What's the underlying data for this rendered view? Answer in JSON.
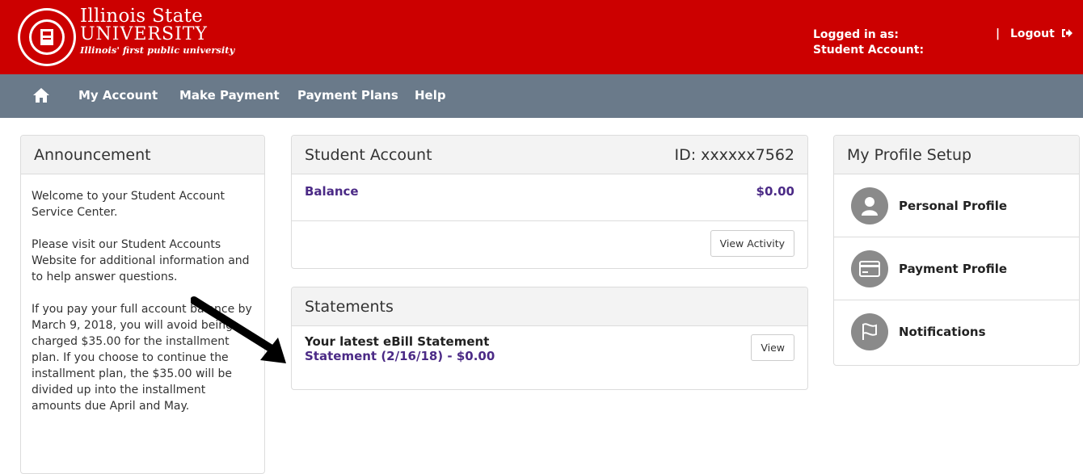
{
  "header": {
    "brand_line1": "Illinois State",
    "brand_line2": "UNIVERSITY",
    "brand_line3": "Illinois' first public university",
    "logged_in_label": "Logged in as:",
    "student_account_label": "Student Account:",
    "logout_label": "Logout",
    "separator": "|",
    "accent_color": "#cc0000"
  },
  "nav": {
    "home_icon": "home-icon",
    "items": [
      "My Account",
      "Make Payment",
      "Payment Plans",
      "Help"
    ]
  },
  "announcement": {
    "title": "Announcement",
    "paragraphs": [
      "Welcome to your Student Account Service Center.",
      "Please visit our Student Accounts Website for additional information and to help answer questions.",
      "If you pay your full account balance by March 9, 2018, you will avoid being charged $35.00 for the installment plan. If you choose to continue the installment plan, the $35.00 will be divided up into the installment amounts due April and May."
    ]
  },
  "student_account": {
    "title": "Student Account",
    "id_label": "ID: xxxxxx7562",
    "balance_label": "Balance",
    "balance_value": "$0.00",
    "view_activity_label": "View Activity"
  },
  "statements": {
    "title": "Statements",
    "latest_label": "Your latest eBill Statement",
    "statement_link": "Statement (2/16/18) - $0.00",
    "view_label": "View"
  },
  "profile": {
    "title": "My Profile Setup",
    "items": [
      {
        "label": "Personal Profile",
        "icon": "person-icon"
      },
      {
        "label": "Payment Profile",
        "icon": "credit-card-icon"
      },
      {
        "label": "Notifications",
        "icon": "flag-icon"
      }
    ]
  }
}
